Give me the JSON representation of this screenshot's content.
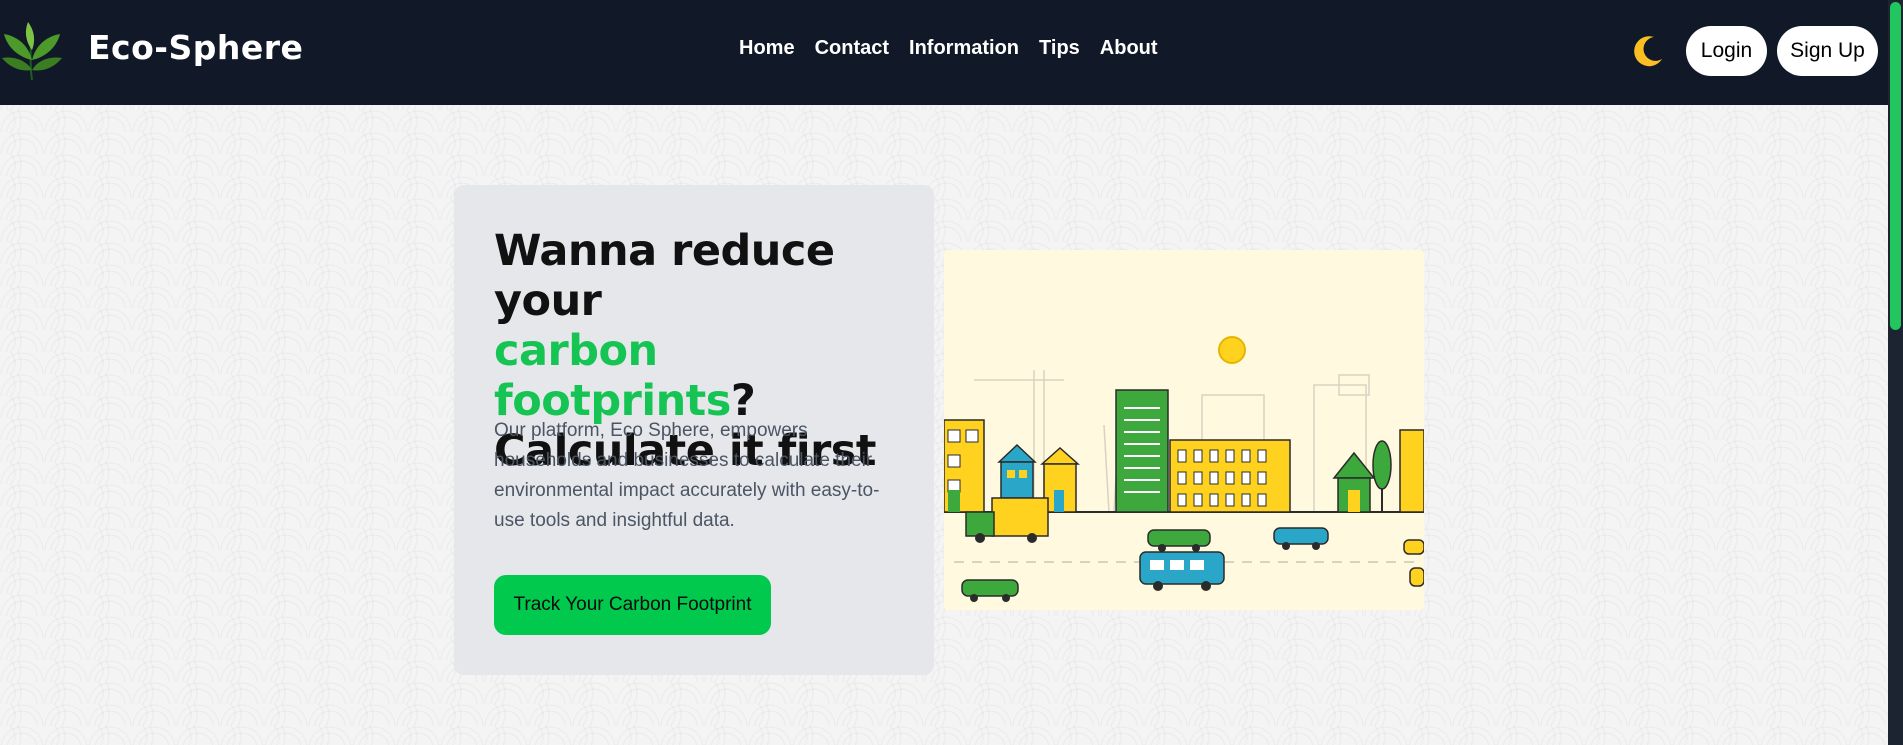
{
  "header": {
    "brand": "Eco-Sphere",
    "nav": [
      {
        "label": "Home"
      },
      {
        "label": "Contact"
      },
      {
        "label": "Information"
      },
      {
        "label": "Tips"
      },
      {
        "label": "About"
      }
    ],
    "theme_toggle_icon": "moon-icon",
    "login_label": "Login",
    "signup_label": "Sign Up"
  },
  "hero": {
    "headline_part1": "Wanna reduce your",
    "headline_accent": "carbon footprints",
    "headline_part2": "?",
    "headline_part3": "Calculate it first",
    "description": "Our platform, Eco Sphere, empowers households and businesses to calculate their environmental impact accurately with easy-to-use tools and insightful data.",
    "cta_label": "Track Your Carbon Footprint"
  },
  "colors": {
    "navbar_bg": "#111827",
    "accent_green": "#16c454",
    "cta_green": "#00c94d",
    "moon_yellow": "#fbbf24",
    "card_bg": "#e5e7eb"
  }
}
